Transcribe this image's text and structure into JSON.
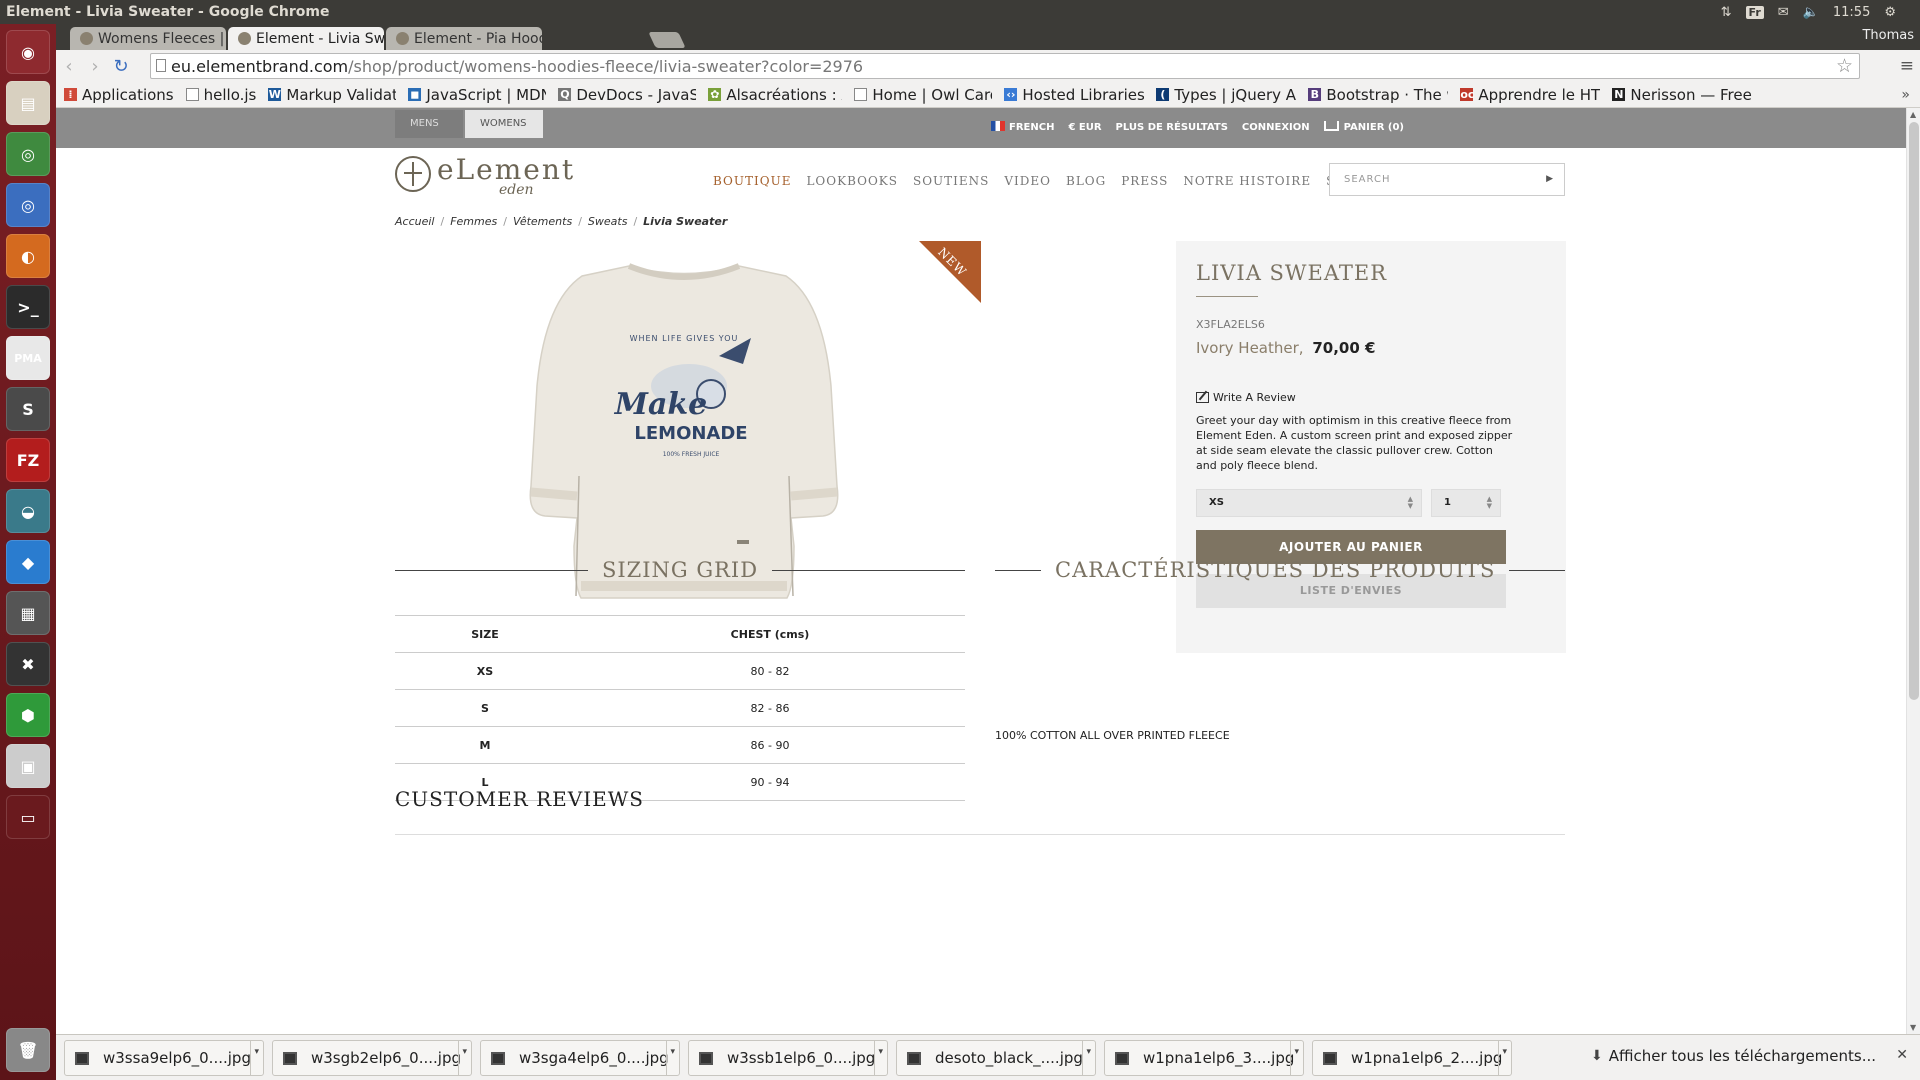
{
  "system": {
    "window_title": "Element - Livia Sweater - Google Chrome",
    "clock": "11:55",
    "keyboard_layout": "Fr",
    "user": "Thomas"
  },
  "launcher": {
    "items": [
      {
        "name": "dash-home",
        "color": "#8e2a2f",
        "glyph": "◉"
      },
      {
        "name": "files",
        "color": "#d8d0c0",
        "glyph": "▤"
      },
      {
        "name": "chrome",
        "color": "#3f8a3f",
        "glyph": "◎"
      },
      {
        "name": "chromium",
        "color": "#3b6ebf",
        "glyph": "◎"
      },
      {
        "name": "firefox",
        "color": "#d46a1f",
        "glyph": "◐"
      },
      {
        "name": "terminal",
        "color": "#2b2b2b",
        "glyph": ">_"
      },
      {
        "name": "phpmyadmin",
        "color": "#e8e8e8",
        "glyph": "PMA"
      },
      {
        "name": "sublime-text",
        "color": "#4a4a4a",
        "glyph": "S"
      },
      {
        "name": "filezilla",
        "color": "#b31d1d",
        "glyph": "FZ"
      },
      {
        "name": "mysql-workbench",
        "color": "#3a7a8a",
        "glyph": "◒"
      },
      {
        "name": "dropbox",
        "color": "#2a7ccf",
        "glyph": "◆"
      },
      {
        "name": "calculator",
        "color": "#555",
        "glyph": "▦"
      },
      {
        "name": "chat",
        "color": "#333",
        "glyph": "✖"
      },
      {
        "name": "cube",
        "color": "#2f9a3a",
        "glyph": "⬢"
      },
      {
        "name": "image-viewer",
        "color": "#ccc",
        "glyph": "▣"
      },
      {
        "name": "workspace-switcher",
        "color": "#6a1a1e",
        "glyph": "▭"
      }
    ],
    "trash": {
      "name": "trash",
      "color": "#888",
      "glyph": "🗑"
    }
  },
  "browser": {
    "tabs": [
      {
        "label": "Womens Fleeces | Zi",
        "active": false
      },
      {
        "label": "Element - Livia Swea",
        "active": true
      },
      {
        "label": "Element - Pia Hoodie",
        "active": false
      }
    ],
    "url_host": "eu.elementbrand.com",
    "url_path": "/shop/product/womens-hoodies-fleece/livia-sweater?color=2976",
    "bookmarks": [
      {
        "label": "Applications",
        "icon_color": "#d04a3a",
        "glyph": "⁞"
      },
      {
        "label": "hello.js",
        "icon_color": "#ffffff",
        "glyph": ""
      },
      {
        "label": "Markup Validatio",
        "icon_color": "#1e5a9a",
        "glyph": "W"
      },
      {
        "label": "JavaScript | MDN",
        "icon_color": "#2a6db5",
        "glyph": "◼"
      },
      {
        "label": "DevDocs - JavaSc",
        "icon_color": "#777777",
        "glyph": "Q"
      },
      {
        "label": "Alsacréations : Ac",
        "icon_color": "#7aa03a",
        "glyph": "✿"
      },
      {
        "label": "Home | Owl Carou",
        "icon_color": "#ffffff",
        "glyph": ""
      },
      {
        "label": "Hosted Libraries",
        "icon_color": "#3a7bd5",
        "glyph": "‹›"
      },
      {
        "label": "Types | jQuery AP",
        "icon_color": "#0d3a73",
        "glyph": "("
      },
      {
        "label": "Bootstrap · The w",
        "icon_color": "#563d7c",
        "glyph": "B"
      },
      {
        "label": "Apprendre le HTM",
        "icon_color": "#c0392b",
        "glyph": "oc"
      },
      {
        "label": "Nerisson — Freel",
        "icon_color": "#222222",
        "glyph": "N"
      }
    ]
  },
  "site": {
    "gender_tabs": [
      {
        "label": "MENS",
        "active": false
      },
      {
        "label": "WOMENS",
        "active": true
      }
    ],
    "util": {
      "language": "FRENCH",
      "currency": "€ EUR",
      "more_results": "PLUS DE RÉSULTATS",
      "login": "CONNEXION",
      "cart": "PANIER (0)"
    },
    "logo": {
      "word": "eLement",
      "sub": "eden"
    },
    "nav": [
      {
        "label": "BOUTIQUE",
        "active": true
      },
      {
        "label": "LOOKBOOKS",
        "active": false
      },
      {
        "label": "SOUTIENS",
        "active": false
      },
      {
        "label": "VIDEO",
        "active": false
      },
      {
        "label": "BLOG",
        "active": false
      },
      {
        "label": "PRESS",
        "active": false
      },
      {
        "label": "NOTRE HISTOIRE",
        "active": false
      },
      {
        "label": "SALE",
        "active": false
      }
    ],
    "search_placeholder": "SEARCH",
    "breadcrumb": [
      "Accueil",
      "Femmes",
      "Vêtements",
      "Sweats",
      "Livia Sweater"
    ]
  },
  "product": {
    "badge": "NEW",
    "title": "LIVIA SWEATER",
    "sku": "X3FLA2ELS6",
    "color_name": "Ivory Heather,",
    "price": "70,00 €",
    "review_link": "Write A Review",
    "description": "Greet your day with optimism in this creative fleece from Element Eden. A custom screen print and exposed zipper at side seam elevate the classic pullover crew. Cotton and poly fleece blend.",
    "size_selected": "XS",
    "quantity": "1",
    "add_to_cart": "AJOUTER AU PANIER",
    "wishlist": "LISTE D'ENVIES",
    "print": {
      "top": "WHEN LIFE GIVES YOU",
      "main1": "Make",
      "main2": "LEMONADE",
      "bottom": "100% FRESH JUICE"
    }
  },
  "sizing": {
    "title": "SIZING GRID",
    "headers": [
      "SIZE",
      "CHEST (cms)"
    ],
    "rows": [
      [
        "XS",
        "80 - 82"
      ],
      [
        "S",
        "82 - 86"
      ],
      [
        "M",
        "86 - 90"
      ],
      [
        "L",
        "90 - 94"
      ]
    ]
  },
  "features": {
    "title": "CARACTÉRISTIQUES DES PRODUITS",
    "text": "100% COTTON ALL OVER PRINTED FLEECE"
  },
  "reviews": {
    "title": "CUSTOMER REVIEWS"
  },
  "downloads": {
    "items": [
      "w3ssa9elp6_0....jpg",
      "w3sgb2elp6_0....jpg",
      "w3sga4elp6_0....jpg",
      "w3ssb1elp6_0....jpg",
      "desoto_black_....jpg",
      "w1pna1elp6_3....jpg",
      "w1pna1elp6_2....jpg"
    ],
    "show_all": "Afficher tous les téléchargements..."
  }
}
